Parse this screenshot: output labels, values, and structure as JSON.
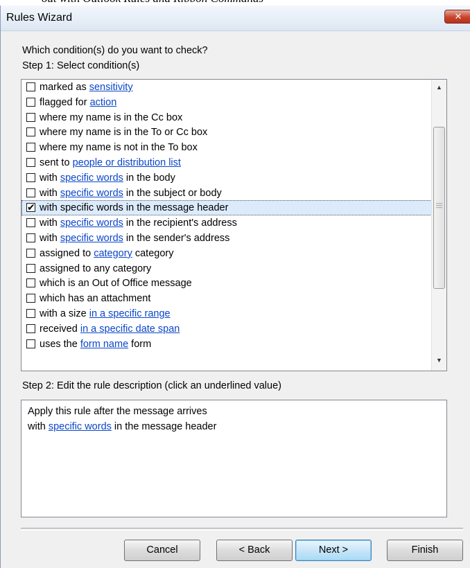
{
  "window": {
    "title": "Rules Wizard",
    "close_label": "✕",
    "behind_text": "out with Outlook Rules and Ribbon Commands"
  },
  "prompt": "Which condition(s) do you want to check?",
  "step1_label": "Step 1: Select condition(s)",
  "conditions": [
    {
      "pre": "marked as ",
      "link": "sensitivity",
      "post": "",
      "checked": false
    },
    {
      "pre": "flagged for ",
      "link": "action",
      "post": "",
      "checked": false
    },
    {
      "pre": "where my name is in the Cc box",
      "link": "",
      "post": "",
      "checked": false
    },
    {
      "pre": "where my name is in the To or Cc box",
      "link": "",
      "post": "",
      "checked": false
    },
    {
      "pre": "where my name is not in the To box",
      "link": "",
      "post": "",
      "checked": false
    },
    {
      "pre": "sent to ",
      "link": "people or distribution list",
      "post": "",
      "checked": false
    },
    {
      "pre": "with ",
      "link": "specific words",
      "post": " in the body",
      "checked": false
    },
    {
      "pre": "with ",
      "link": "specific words",
      "post": " in the subject or body",
      "checked": false
    },
    {
      "pre": "with specific words in the message header",
      "link": "",
      "post": "",
      "checked": true,
      "selected": true
    },
    {
      "pre": "with ",
      "link": "specific words",
      "post": " in the recipient's address",
      "checked": false
    },
    {
      "pre": "with ",
      "link": "specific words",
      "post": " in the sender's address",
      "checked": false
    },
    {
      "pre": "assigned to ",
      "link": "category",
      "post": " category",
      "checked": false
    },
    {
      "pre": "assigned to any category",
      "link": "",
      "post": "",
      "checked": false
    },
    {
      "pre": "which is an Out of Office message",
      "link": "",
      "post": "",
      "checked": false
    },
    {
      "pre": "which has an attachment",
      "link": "",
      "post": "",
      "checked": false
    },
    {
      "pre": "with a size ",
      "link": "in a specific range",
      "post": "",
      "checked": false
    },
    {
      "pre": "received ",
      "link": "in a specific date span",
      "post": "",
      "checked": false
    },
    {
      "pre": "uses the ",
      "link": "form name",
      "post": " form",
      "checked": false
    }
  ],
  "step2_label": "Step 2: Edit the rule description (click an underlined value)",
  "description": {
    "line1": "Apply this rule after the message arrives",
    "line2_pre": "with ",
    "line2_link": "specific words",
    "line2_post": " in the message header"
  },
  "buttons": {
    "cancel": "Cancel",
    "back": "< Back",
    "next": "Next >",
    "finish": "Finish"
  },
  "icons": {
    "scroll_up": "scroll-up-arrow-icon",
    "scroll_down": "scroll-down-arrow-icon",
    "check": "checkmark-icon",
    "close": "close-icon"
  }
}
